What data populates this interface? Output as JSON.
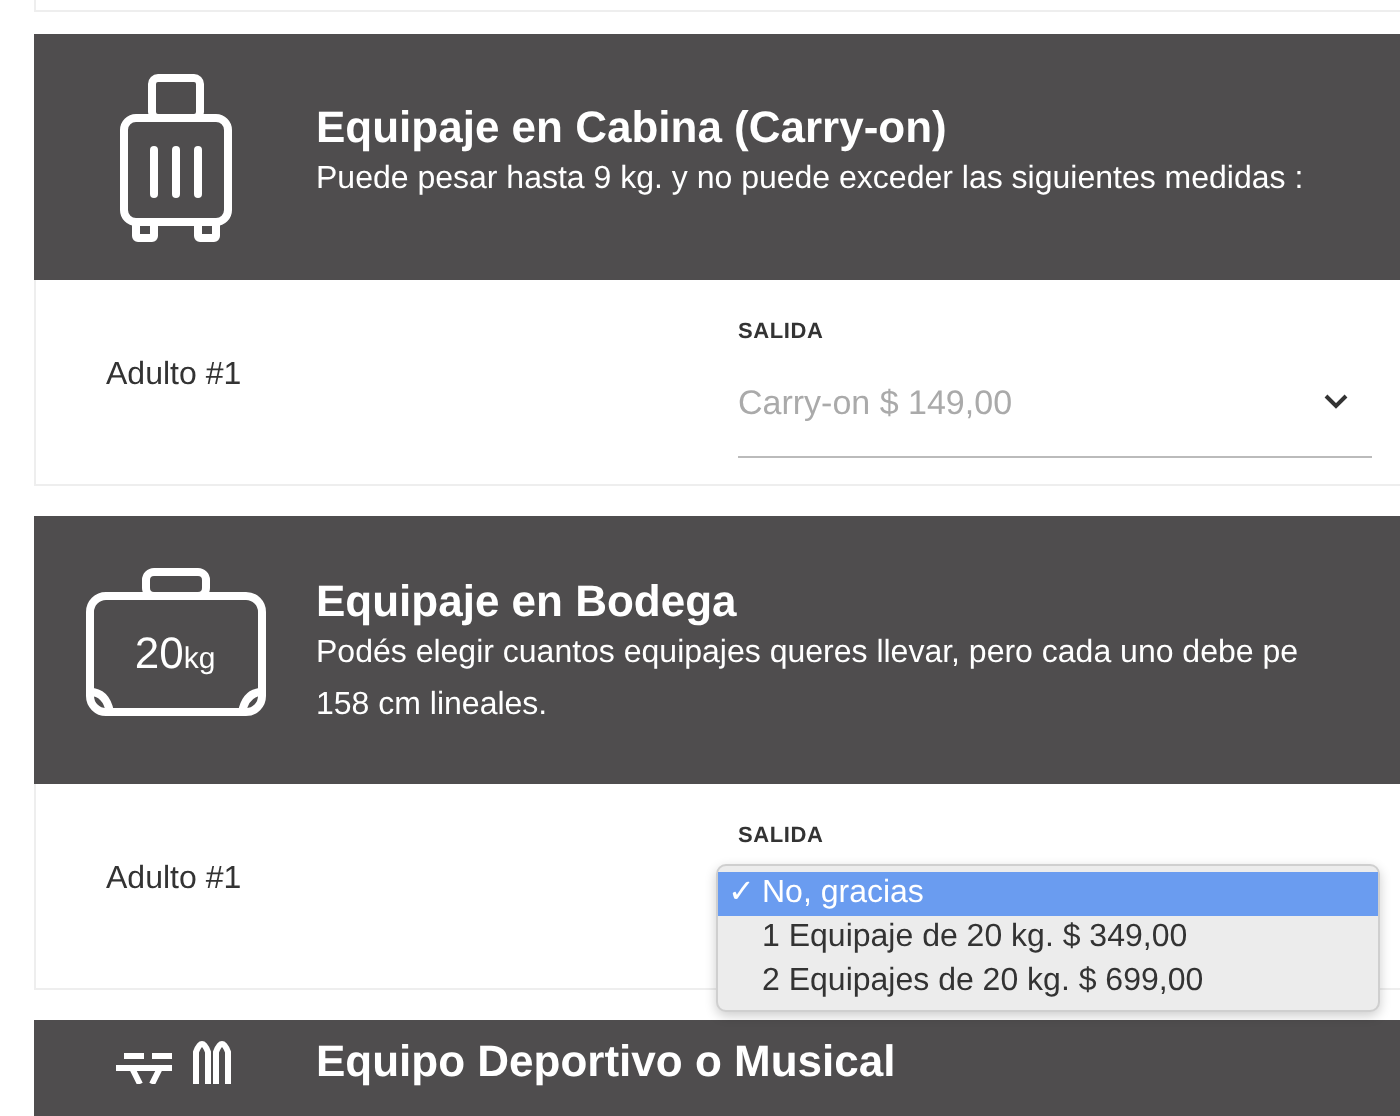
{
  "sections": [
    {
      "kind": "cabin",
      "title": "Equipaje en Cabina (Carry-on)",
      "description_lines": [
        "Puede pesar hasta 9 kg. y no puede exceder las siguientes medidas :"
      ],
      "passenger": "Adulto #1",
      "field_label": "SALIDA",
      "value": "Carry-on $ 149,00",
      "open": false
    },
    {
      "kind": "hold",
      "title": "Equipaje en Bodega",
      "weight": "20",
      "unit": "kg",
      "description_lines": [
        "Podés elegir cuantos equipajes queres llevar, pero cada uno debe pe",
        "158 cm lineales."
      ],
      "passenger": "Adulto #1",
      "field_label": "SALIDA",
      "open": true,
      "check_mark": "✓",
      "options": [
        {
          "label": "No, gracias",
          "selected": true
        },
        {
          "label": "1 Equipaje de 20 kg. $ 349,00",
          "selected": false
        },
        {
          "label": "2 Equipajes de 20 kg. $ 699,00",
          "selected": false
        }
      ]
    },
    {
      "kind": "sports",
      "title": "Equipo Deportivo o Musical"
    }
  ]
}
